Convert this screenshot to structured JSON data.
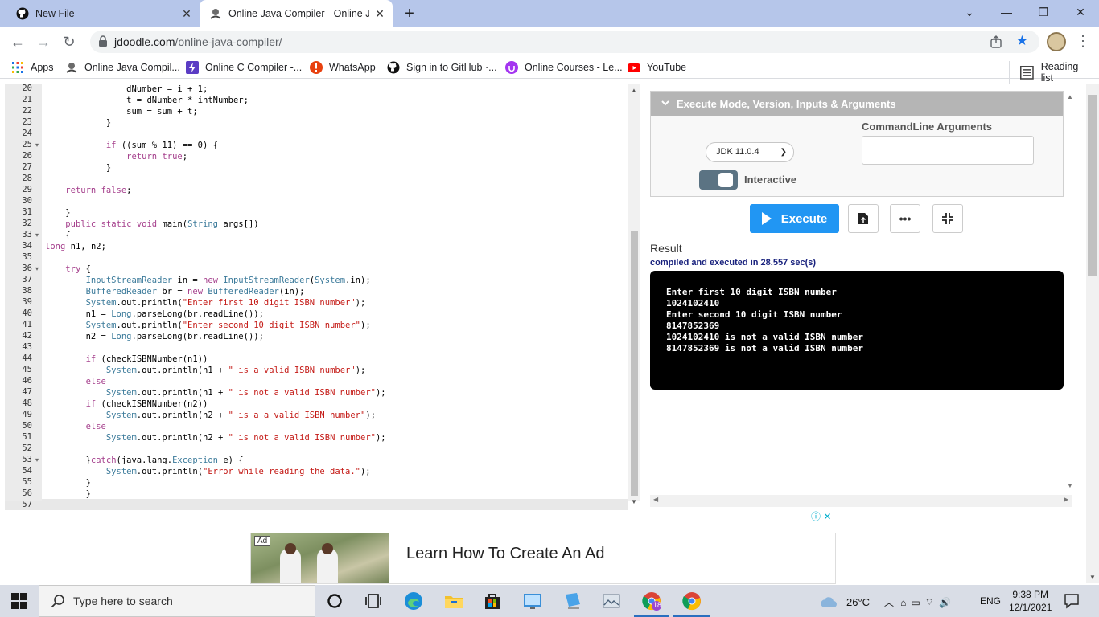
{
  "browser": {
    "tabs": [
      {
        "title": "New File",
        "icon": "github-icon"
      },
      {
        "title": "Online Java Compiler - Online Ja",
        "icon": "jdoodle-icon",
        "active": true
      }
    ],
    "url_host": "jdoodle.com",
    "url_path": "/online-java-compiler/",
    "bookmarks": [
      {
        "label": "Apps",
        "icon": "apps-grid-icon"
      },
      {
        "label": "Online Java Compil...",
        "icon": "jdoodle-icon"
      },
      {
        "label": "Online C Compiler -...",
        "icon": "bolt-icon"
      },
      {
        "label": "WhatsApp",
        "icon": "alert-icon"
      },
      {
        "label": "Sign in to GitHub ·...",
        "icon": "github-icon"
      },
      {
        "label": "Online Courses - Le...",
        "icon": "udemy-icon"
      },
      {
        "label": "YouTube",
        "icon": "youtube-icon"
      }
    ],
    "reading_list": "Reading list"
  },
  "editor": {
    "line_numbers": [
      "20",
      "21",
      "22",
      "23",
      "24",
      "25",
      "26",
      "27",
      "28",
      "29",
      "30",
      "31",
      "32",
      "33",
      "34",
      "35",
      "36",
      "37",
      "38",
      "39",
      "40",
      "41",
      "42",
      "43",
      "44",
      "45",
      "46",
      "47",
      "48",
      "49",
      "50",
      "51",
      "52",
      "53",
      "54",
      "55",
      "56",
      "57"
    ],
    "fold_lines": [
      "25",
      "33",
      "36",
      "53"
    ],
    "lines": [
      "                dNumber = i + 1;",
      "                t = dNumber * intNumber;",
      "                sum = sum + t;",
      "            }",
      "",
      "            if ((sum % 11) == 0) {",
      "                return true;",
      "            }",
      "",
      "    return false;",
      "",
      "    }",
      "    public static void main(String args[])",
      "    {",
      "long n1, n2;",
      "",
      "    try {",
      "        InputStreamReader in = new InputStreamReader(System.in);",
      "        BufferedReader br = new BufferedReader(in);",
      "        System.out.println(\"Enter first 10 digit ISBN number\");",
      "        n1 = Long.parseLong(br.readLine());",
      "        System.out.println(\"Enter second 10 digit ISBN number\");",
      "        n2 = Long.parseLong(br.readLine());",
      "",
      "        if (checkISBNNumber(n1))",
      "            System.out.println(n1 + \" is a valid ISBN number\");",
      "        else",
      "            System.out.println(n1 + \" is not a valid ISBN number\");",
      "        if (checkISBNNumber(n2))",
      "            System.out.println(n2 + \" is a a valid ISBN number\");",
      "        else",
      "            System.out.println(n2 + \" is not a valid ISBN number\");",
      "",
      "        }catch(java.lang.Exception e) {",
      "            System.out.println(\"Error while reading the data.\");",
      "        }",
      "        }",
      "}"
    ]
  },
  "panel": {
    "header": "Execute Mode, Version, Inputs & Arguments",
    "jdk_version": "JDK 11.0.4",
    "cmd_label": "CommandLine Arguments",
    "cmd_value": "",
    "interactive_label": "Interactive",
    "interactive_on": true,
    "execute_label": "Execute",
    "more_label": "•••",
    "result_label": "Result",
    "compile_status": "compiled and executed in 28.557 sec(s)",
    "output_lines": [
      "Enter first 10 digit ISBN number",
      "1024102410",
      "Enter second 10 digit ISBN number",
      "8147852369",
      "1024102410 is not a valid ISBN number",
      "8147852369 is not a valid ISBN number"
    ]
  },
  "ad": {
    "badge": "Ad",
    "headline": "Learn How To Create An Ad"
  },
  "taskbar": {
    "search_placeholder": "Type here to search",
    "weather": "26°C",
    "language": "ENG",
    "time": "9:38 PM",
    "date": "12/1/2021",
    "chrome_badge": "18"
  },
  "colors": {
    "tabstrip": "#b6c6ea",
    "execute": "#2196f3",
    "keyword": "#a53f8c",
    "string": "#c41a16",
    "type": "#3b7a9a"
  }
}
